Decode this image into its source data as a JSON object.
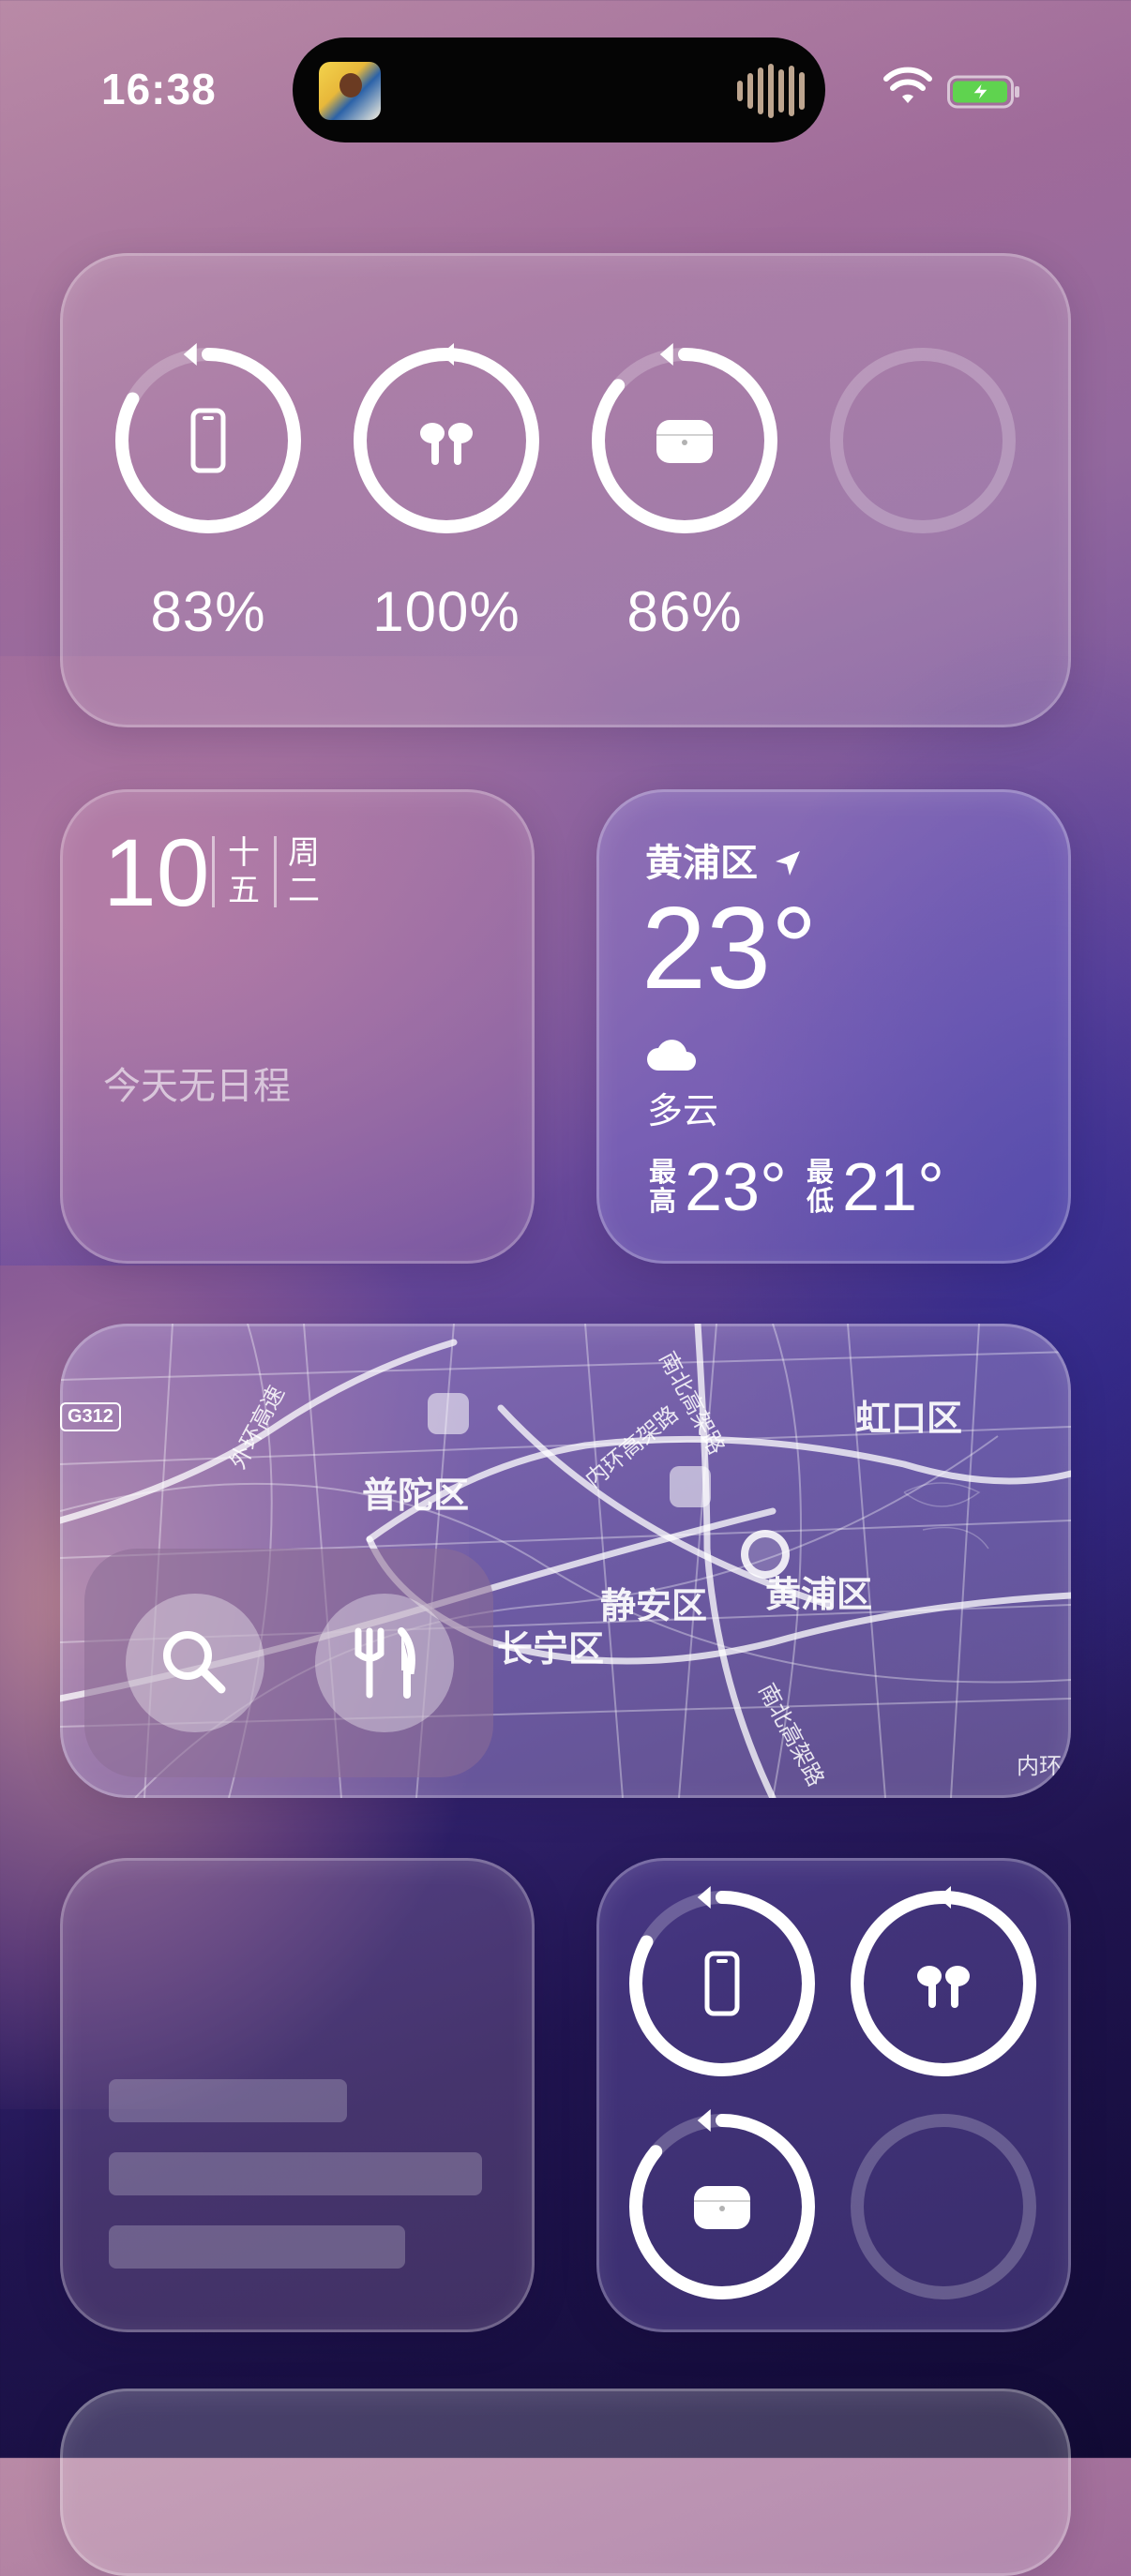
{
  "status_bar": {
    "time": "16:38"
  },
  "battery_widget_large": {
    "items": [
      {
        "device": "iphone-icon",
        "percent": "83%",
        "level": 0.83
      },
      {
        "device": "airpods-icon",
        "percent": "100%",
        "level": 1.0
      },
      {
        "device": "airpods-case-icon",
        "percent": "86%",
        "level": 0.86
      },
      {
        "device": "empty-slot",
        "percent": "",
        "level": 0
      }
    ]
  },
  "calendar_widget": {
    "day": "10",
    "lunar_line1": "十",
    "lunar_line2": "五",
    "weekday_line1": "周",
    "weekday_line2": "二",
    "note": "今天无日程"
  },
  "weather_widget": {
    "location": "黄浦区",
    "temperature": "23°",
    "condition": "多云",
    "high_label_1": "最",
    "high_label_2": "高",
    "high": "23°",
    "low_label_1": "最",
    "low_label_2": "低",
    "low": "21°"
  },
  "map_widget": {
    "districts": [
      "普陀区",
      "虹口区",
      "静安区",
      "黄浦区",
      "长宁区"
    ],
    "roads": [
      "外环高速",
      "南北高架路",
      "内环高架路",
      "南北高架路",
      "内环"
    ],
    "road_shield": "G312"
  },
  "battery_widget_small": {
    "items": [
      {
        "device": "iphone-icon",
        "level": 0.83
      },
      {
        "device": "airpods-icon",
        "level": 1.0
      },
      {
        "device": "airpods-case-icon",
        "level": 0.86
      },
      {
        "device": "empty-slot",
        "level": 0
      }
    ]
  },
  "colors": {
    "ring": "#ffffff",
    "ring_track": "rgba(255,255,255,0.22)"
  }
}
